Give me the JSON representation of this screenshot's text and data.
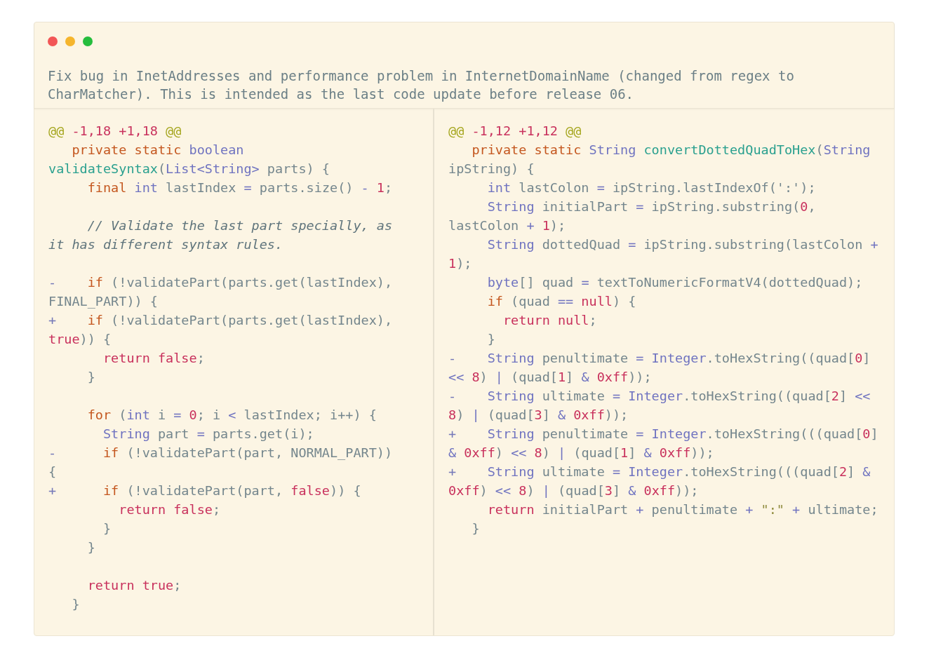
{
  "commit_message": "Fix bug in InetAddresses and performance problem in InternetDomainName (changed from regex to CharMatcher). This is intended as the last code update before release 06.",
  "panes": [
    {
      "lines": [
        {
          "kind": "code",
          "tokens": [
            {
              "kind": "hunk",
              "text": "@@"
            },
            {
              "kind": "number",
              "text": " -1,18"
            },
            {
              "kind": "number",
              "text": " +1,18"
            },
            {
              "kind": "hunk",
              "text": " @@"
            }
          ]
        },
        {
          "kind": "code",
          "tokens": [
            {
              "kind": "keyword",
              "text": "   private"
            },
            {
              "kind": "keyword",
              "text": " static"
            },
            {
              "kind": "type",
              "text": " boolean"
            },
            {
              "kind": "function",
              "text": " validateSyntax"
            },
            {
              "kind": "plain",
              "text": "("
            },
            {
              "kind": "type",
              "text": "List<String>"
            },
            {
              "kind": "plain",
              "text": " parts) {"
            }
          ]
        },
        {
          "kind": "code",
          "tokens": [
            {
              "kind": "keyword",
              "text": "     final"
            },
            {
              "kind": "type",
              "text": " int"
            },
            {
              "kind": "plain",
              "text": " lastIndex "
            },
            {
              "kind": "operator",
              "text": "="
            },
            {
              "kind": "plain",
              "text": " parts.size() "
            },
            {
              "kind": "operator",
              "text": "-"
            },
            {
              "kind": "number",
              "text": " 1"
            },
            {
              "kind": "plain",
              "text": ";"
            }
          ]
        },
        {
          "kind": "blank"
        },
        {
          "kind": "code",
          "tokens": [
            {
              "kind": "comment",
              "text": "     // Validate the last part specially, as it has different syntax rules."
            }
          ]
        },
        {
          "kind": "blank"
        },
        {
          "kind": "code",
          "tokens": [
            {
              "kind": "marker",
              "text": "-"
            },
            {
              "kind": "keyword",
              "text": "    if"
            },
            {
              "kind": "plain",
              "text": " (!validatePart(parts.get(lastIndex), FINAL_PART)) {"
            }
          ]
        },
        {
          "kind": "code",
          "tokens": [
            {
              "kind": "marker",
              "text": "+"
            },
            {
              "kind": "keyword",
              "text": "    if"
            },
            {
              "kind": "plain",
              "text": " (!validatePart(parts.get(lastIndex), "
            },
            {
              "kind": "literal",
              "text": "true"
            },
            {
              "kind": "plain",
              "text": ")) {"
            }
          ]
        },
        {
          "kind": "code",
          "tokens": [
            {
              "kind": "literal",
              "text": "       return"
            },
            {
              "kind": "literal",
              "text": " false"
            },
            {
              "kind": "plain",
              "text": ";"
            }
          ]
        },
        {
          "kind": "code",
          "tokens": [
            {
              "kind": "plain",
              "text": "     }"
            }
          ]
        },
        {
          "kind": "blank"
        },
        {
          "kind": "code",
          "tokens": [
            {
              "kind": "keyword",
              "text": "     for"
            },
            {
              "kind": "plain",
              "text": " ("
            },
            {
              "kind": "type",
              "text": "int"
            },
            {
              "kind": "plain",
              "text": " i "
            },
            {
              "kind": "operator",
              "text": "="
            },
            {
              "kind": "number",
              "text": " 0"
            },
            {
              "kind": "plain",
              "text": "; i "
            },
            {
              "kind": "operator",
              "text": "<"
            },
            {
              "kind": "plain",
              "text": " lastIndex; i++) {"
            }
          ]
        },
        {
          "kind": "code",
          "tokens": [
            {
              "kind": "type",
              "text": "       String"
            },
            {
              "kind": "plain",
              "text": " part "
            },
            {
              "kind": "operator",
              "text": "="
            },
            {
              "kind": "plain",
              "text": " parts.get(i);"
            }
          ]
        },
        {
          "kind": "code",
          "tokens": [
            {
              "kind": "marker",
              "text": "-"
            },
            {
              "kind": "keyword",
              "text": "      if"
            },
            {
              "kind": "plain",
              "text": " (!validatePart(part, NORMAL_PART)) {"
            }
          ]
        },
        {
          "kind": "code",
          "tokens": [
            {
              "kind": "marker",
              "text": "+"
            },
            {
              "kind": "keyword",
              "text": "      if"
            },
            {
              "kind": "plain",
              "text": " (!validatePart(part, "
            },
            {
              "kind": "literal",
              "text": "false"
            },
            {
              "kind": "plain",
              "text": ")) {"
            }
          ]
        },
        {
          "kind": "code",
          "tokens": [
            {
              "kind": "literal",
              "text": "         return"
            },
            {
              "kind": "literal",
              "text": " false"
            },
            {
              "kind": "plain",
              "text": ";"
            }
          ]
        },
        {
          "kind": "code",
          "tokens": [
            {
              "kind": "plain",
              "text": "       }"
            }
          ]
        },
        {
          "kind": "code",
          "tokens": [
            {
              "kind": "plain",
              "text": "     }"
            }
          ]
        },
        {
          "kind": "blank"
        },
        {
          "kind": "code",
          "tokens": [
            {
              "kind": "literal",
              "text": "     return"
            },
            {
              "kind": "literal",
              "text": " true"
            },
            {
              "kind": "plain",
              "text": ";"
            }
          ]
        },
        {
          "kind": "code",
          "tokens": [
            {
              "kind": "plain",
              "text": "   }"
            }
          ]
        }
      ]
    },
    {
      "lines": [
        {
          "kind": "code",
          "tokens": [
            {
              "kind": "hunk",
              "text": "@@"
            },
            {
              "kind": "number",
              "text": " -1,12"
            },
            {
              "kind": "number",
              "text": " +1,12"
            },
            {
              "kind": "hunk",
              "text": " @@"
            }
          ]
        },
        {
          "kind": "code",
          "tokens": [
            {
              "kind": "keyword",
              "text": "   private"
            },
            {
              "kind": "keyword",
              "text": " static"
            },
            {
              "kind": "type",
              "text": " String"
            },
            {
              "kind": "function",
              "text": " convertDottedQuadToHex"
            },
            {
              "kind": "plain",
              "text": "("
            },
            {
              "kind": "type",
              "text": "String"
            },
            {
              "kind": "plain",
              "text": " ipString) {"
            }
          ]
        },
        {
          "kind": "code",
          "tokens": [
            {
              "kind": "type",
              "text": "     int"
            },
            {
              "kind": "plain",
              "text": " lastColon "
            },
            {
              "kind": "operator",
              "text": "="
            },
            {
              "kind": "plain",
              "text": " ipString.lastIndexOf(':');"
            }
          ]
        },
        {
          "kind": "code",
          "tokens": [
            {
              "kind": "type",
              "text": "     String"
            },
            {
              "kind": "plain",
              "text": " initialPart "
            },
            {
              "kind": "operator",
              "text": "="
            },
            {
              "kind": "plain",
              "text": " ipString.substring("
            },
            {
              "kind": "number",
              "text": "0"
            },
            {
              "kind": "plain",
              "text": ", lastColon "
            },
            {
              "kind": "operator",
              "text": "+"
            },
            {
              "kind": "number",
              "text": " 1"
            },
            {
              "kind": "plain",
              "text": ");"
            }
          ]
        },
        {
          "kind": "code",
          "tokens": [
            {
              "kind": "type",
              "text": "     String"
            },
            {
              "kind": "plain",
              "text": " dottedQuad "
            },
            {
              "kind": "operator",
              "text": "="
            },
            {
              "kind": "plain",
              "text": " ipString.substring(lastColon "
            },
            {
              "kind": "operator",
              "text": "+"
            },
            {
              "kind": "number",
              "text": " 1"
            },
            {
              "kind": "plain",
              "text": ");"
            }
          ]
        },
        {
          "kind": "code",
          "tokens": [
            {
              "kind": "type",
              "text": "     byte"
            },
            {
              "kind": "plain",
              "text": "[] quad "
            },
            {
              "kind": "operator",
              "text": "="
            },
            {
              "kind": "plain",
              "text": " textToNumericFormatV4(dottedQuad);"
            }
          ]
        },
        {
          "kind": "code",
          "tokens": [
            {
              "kind": "keyword",
              "text": "     if"
            },
            {
              "kind": "plain",
              "text": " (quad "
            },
            {
              "kind": "operator",
              "text": "=="
            },
            {
              "kind": "literal",
              "text": " null"
            },
            {
              "kind": "plain",
              "text": ") {"
            }
          ]
        },
        {
          "kind": "code",
          "tokens": [
            {
              "kind": "literal",
              "text": "       return"
            },
            {
              "kind": "literal",
              "text": " null"
            },
            {
              "kind": "plain",
              "text": ";"
            }
          ]
        },
        {
          "kind": "code",
          "tokens": [
            {
              "kind": "plain",
              "text": "     }"
            }
          ]
        },
        {
          "kind": "code",
          "tokens": [
            {
              "kind": "marker",
              "text": "-"
            },
            {
              "kind": "type",
              "text": "    String"
            },
            {
              "kind": "plain",
              "text": " penultimate "
            },
            {
              "kind": "operator",
              "text": "="
            },
            {
              "kind": "type",
              "text": " Integer"
            },
            {
              "kind": "plain",
              "text": ".toHexString((quad["
            },
            {
              "kind": "number",
              "text": "0"
            },
            {
              "kind": "plain",
              "text": "] "
            },
            {
              "kind": "operator",
              "text": "<<"
            },
            {
              "kind": "number",
              "text": " 8"
            },
            {
              "kind": "plain",
              "text": ") "
            },
            {
              "kind": "operator",
              "text": "|"
            },
            {
              "kind": "plain",
              "text": " (quad["
            },
            {
              "kind": "number",
              "text": "1"
            },
            {
              "kind": "plain",
              "text": "] "
            },
            {
              "kind": "operator",
              "text": "&"
            },
            {
              "kind": "number",
              "text": " 0xff"
            },
            {
              "kind": "plain",
              "text": "));"
            }
          ]
        },
        {
          "kind": "code",
          "tokens": [
            {
              "kind": "marker",
              "text": "-"
            },
            {
              "kind": "type",
              "text": "    String"
            },
            {
              "kind": "plain",
              "text": " ultimate "
            },
            {
              "kind": "operator",
              "text": "="
            },
            {
              "kind": "type",
              "text": " Integer"
            },
            {
              "kind": "plain",
              "text": ".toHexString((quad["
            },
            {
              "kind": "number",
              "text": "2"
            },
            {
              "kind": "plain",
              "text": "] "
            },
            {
              "kind": "operator",
              "text": "<<"
            },
            {
              "kind": "number",
              "text": " 8"
            },
            {
              "kind": "plain",
              "text": ") "
            },
            {
              "kind": "operator",
              "text": "|"
            },
            {
              "kind": "plain",
              "text": " (quad["
            },
            {
              "kind": "number",
              "text": "3"
            },
            {
              "kind": "plain",
              "text": "] "
            },
            {
              "kind": "operator",
              "text": "&"
            },
            {
              "kind": "number",
              "text": " 0xff"
            },
            {
              "kind": "plain",
              "text": "));"
            }
          ]
        },
        {
          "kind": "code",
          "tokens": [
            {
              "kind": "marker",
              "text": "+"
            },
            {
              "kind": "type",
              "text": "    String"
            },
            {
              "kind": "plain",
              "text": " penultimate "
            },
            {
              "kind": "operator",
              "text": "="
            },
            {
              "kind": "type",
              "text": " Integer"
            },
            {
              "kind": "plain",
              "text": ".toHexString(((quad["
            },
            {
              "kind": "number",
              "text": "0"
            },
            {
              "kind": "plain",
              "text": "] "
            },
            {
              "kind": "operator",
              "text": "&"
            },
            {
              "kind": "number",
              "text": " 0xff"
            },
            {
              "kind": "plain",
              "text": ") "
            },
            {
              "kind": "operator",
              "text": "<<"
            },
            {
              "kind": "number",
              "text": " 8"
            },
            {
              "kind": "plain",
              "text": ") "
            },
            {
              "kind": "operator",
              "text": "|"
            },
            {
              "kind": "plain",
              "text": " (quad["
            },
            {
              "kind": "number",
              "text": "1"
            },
            {
              "kind": "plain",
              "text": "] "
            },
            {
              "kind": "operator",
              "text": "&"
            },
            {
              "kind": "number",
              "text": " 0xff"
            },
            {
              "kind": "plain",
              "text": "));"
            }
          ]
        },
        {
          "kind": "code",
          "tokens": [
            {
              "kind": "marker",
              "text": "+"
            },
            {
              "kind": "type",
              "text": "    String"
            },
            {
              "kind": "plain",
              "text": " ultimate "
            },
            {
              "kind": "operator",
              "text": "="
            },
            {
              "kind": "type",
              "text": " Integer"
            },
            {
              "kind": "plain",
              "text": ".toHexString(((quad["
            },
            {
              "kind": "number",
              "text": "2"
            },
            {
              "kind": "plain",
              "text": "] "
            },
            {
              "kind": "operator",
              "text": "&"
            },
            {
              "kind": "number",
              "text": " 0xff"
            },
            {
              "kind": "plain",
              "text": ") "
            },
            {
              "kind": "operator",
              "text": "<<"
            },
            {
              "kind": "number",
              "text": " 8"
            },
            {
              "kind": "plain",
              "text": ") "
            },
            {
              "kind": "operator",
              "text": "|"
            },
            {
              "kind": "plain",
              "text": " (quad["
            },
            {
              "kind": "number",
              "text": "3"
            },
            {
              "kind": "plain",
              "text": "] "
            },
            {
              "kind": "operator",
              "text": "&"
            },
            {
              "kind": "number",
              "text": " 0xff"
            },
            {
              "kind": "plain",
              "text": "));"
            }
          ]
        },
        {
          "kind": "code",
          "tokens": [
            {
              "kind": "literal",
              "text": "     return"
            },
            {
              "kind": "plain",
              "text": " initialPart "
            },
            {
              "kind": "operator",
              "text": "+"
            },
            {
              "kind": "plain",
              "text": " penultimate "
            },
            {
              "kind": "operator",
              "text": "+"
            },
            {
              "kind": "string",
              "text": " \":\""
            },
            {
              "kind": "operator",
              "text": " +"
            },
            {
              "kind": "plain",
              "text": " ultimate;"
            }
          ]
        },
        {
          "kind": "code",
          "tokens": [
            {
              "kind": "plain",
              "text": "   }"
            }
          ]
        }
      ]
    }
  ]
}
